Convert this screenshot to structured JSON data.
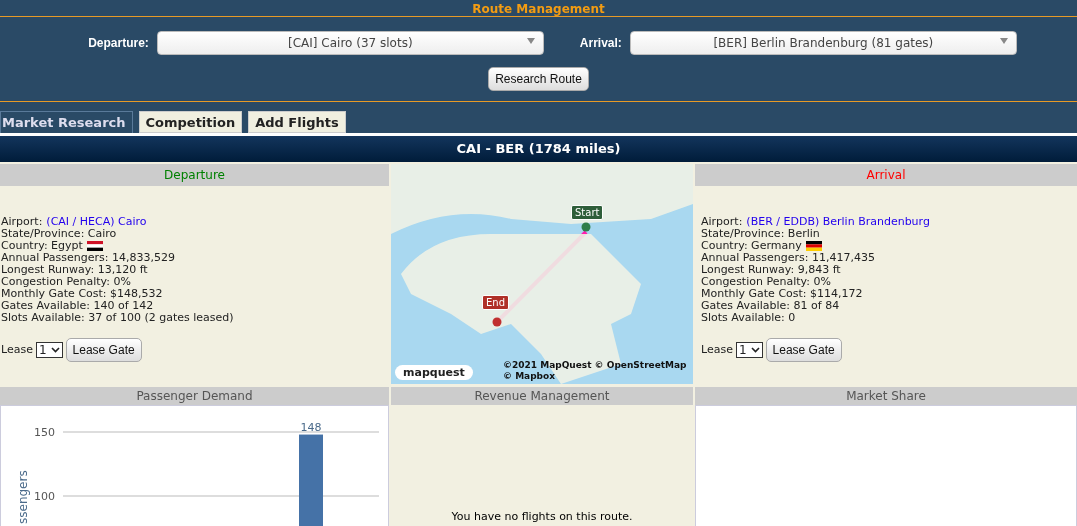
{
  "page_title": "Route Management",
  "selectors": [
    {
      "label": "Departure:",
      "value": "[CAI] Cairo (37 slots)"
    },
    {
      "label": "Arrival:",
      "value": "[BER] Berlin Brandenburg (81 gates)"
    }
  ],
  "research_button": "Research Route",
  "tabs": [
    {
      "label": "Market Research",
      "selected": true
    },
    {
      "label": "Competition",
      "selected": false
    },
    {
      "label": "Add Flights",
      "selected": false
    }
  ],
  "route_title": "CAI - BER (1784 miles)",
  "airports": [
    {
      "kind": "departure",
      "heading": "Departure",
      "color": "#008000",
      "airport_label": "Airport:",
      "airport_link": "(CAI / HECA) Cairo",
      "lines": [
        "State/Province: Cairo",
        "Country: Egypt",
        "Annual Passengers: 14,833,529",
        "Longest Runway: 13,120 ft",
        "Congestion Penalty: 0%",
        "Monthly Gate Cost: $148,532",
        "Gates Available: 140 of 142",
        "Slots Available: 37 of 100 (2 gates leased)"
      ],
      "lease_label": "Lease",
      "lease_value": "1",
      "lease_button": "Lease Gate"
    },
    {
      "kind": "arrival",
      "heading": "Arrival",
      "color": "#ff0000",
      "airport_label": "Airport:",
      "airport_link": "(BER / EDDB) Berlin Brandenburg",
      "lines": [
        "State/Province: Berlin",
        "Country: Germany",
        "Annual Passengers: 11,417,435",
        "Longest Runway: 9,843 ft",
        "Congestion Penalty: 0%",
        "Monthly Gate Cost: $114,172",
        "Gates Available: 81 of 84",
        "Slots Available: 0"
      ],
      "lease_label": "Lease",
      "lease_value": "1",
      "lease_button": "Lease Gate"
    }
  ],
  "map": {
    "start_label": "Start",
    "end_label": "End",
    "logo": "mapquest",
    "attribution": "©2021 MapQuest © OpenStreetMap © Mapbox"
  },
  "sections": [
    {
      "title": "Passenger Demand"
    },
    {
      "title": "Revenue Management"
    },
    {
      "title": "Market Share"
    }
  ],
  "passenger_demand": {
    "chart_data": {
      "type": "bar",
      "ylabel": "ssengers",
      "values": [
        148
      ],
      "ylim": [
        0,
        150
      ],
      "yticks": [
        100,
        150
      ],
      "data_labels": true
    }
  },
  "revenue_message": "You have no flights on this route."
}
